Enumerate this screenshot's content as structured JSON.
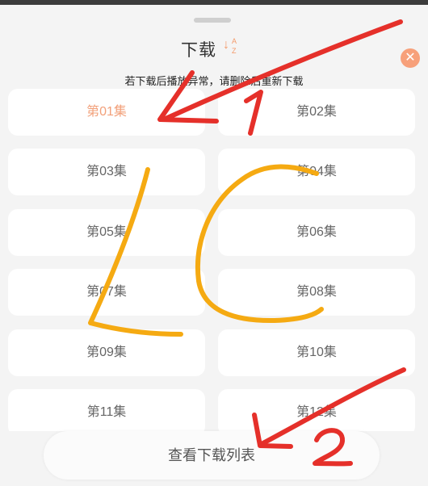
{
  "sheet": {
    "title": "下载",
    "sort_icon": {
      "a": "A",
      "z": "Z"
    },
    "close_symbol": "✕",
    "hint": "若下载后播放异常，请删除后重新下载"
  },
  "episodes": [
    {
      "label": "第01集",
      "active": true
    },
    {
      "label": "第02集",
      "active": false
    },
    {
      "label": "第03集",
      "active": false
    },
    {
      "label": "第04集",
      "active": false
    },
    {
      "label": "第05集",
      "active": false
    },
    {
      "label": "第06集",
      "active": false
    },
    {
      "label": "第07集",
      "active": false
    },
    {
      "label": "第08集",
      "active": false
    },
    {
      "label": "第09集",
      "active": false
    },
    {
      "label": "第10集",
      "active": false
    },
    {
      "label": "第11集",
      "active": false
    },
    {
      "label": "第12集",
      "active": false
    }
  ],
  "footer": {
    "view_downloads_label": "查看下载列表"
  },
  "annotations": {
    "label_1": "1",
    "label_2": "2",
    "letters": "LC",
    "red_color": "#e5302a",
    "orange_color": "#f5aa12"
  }
}
